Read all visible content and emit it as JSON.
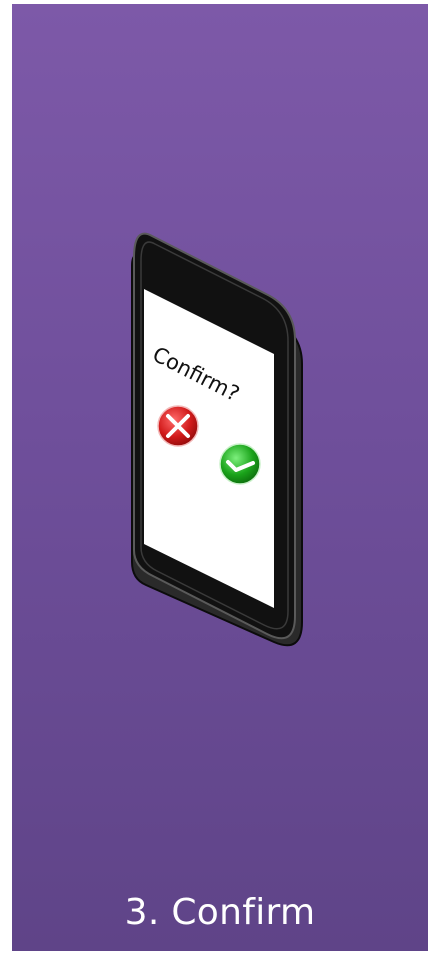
{
  "illustration": {
    "screen_prompt": "Confirm?",
    "cancel_icon": "x-icon",
    "confirm_icon": "check-icon",
    "cancel_color": "#d11a1a",
    "confirm_color": "#1aa31a"
  },
  "caption": {
    "label": "3. Confirm"
  },
  "theme": {
    "panel_top": "#7d59a8",
    "panel_bottom": "#5f4488"
  }
}
